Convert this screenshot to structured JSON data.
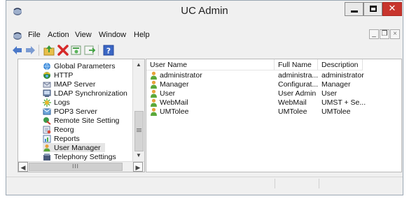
{
  "window": {
    "title": "UC Admin"
  },
  "menubar": {
    "items": [
      "File",
      "Action",
      "View",
      "Window",
      "Help"
    ]
  },
  "toolbar": {
    "icons": [
      "back-arrow-icon",
      "forward-arrow-icon",
      "up-folder-icon",
      "delete-icon",
      "properties-icon",
      "export-icon",
      "help-icon"
    ]
  },
  "tree": {
    "items": [
      {
        "label": "Global Parameters",
        "icon": "global-parameters-icon"
      },
      {
        "label": "HTTP",
        "icon": "http-icon"
      },
      {
        "label": "IMAP Server",
        "icon": "imap-server-icon"
      },
      {
        "label": "LDAP Synchronization",
        "icon": "ldap-sync-icon"
      },
      {
        "label": "Logs",
        "icon": "logs-icon"
      },
      {
        "label": "POP3 Server",
        "icon": "pop3-server-icon"
      },
      {
        "label": "Remote Site Setting",
        "icon": "remote-site-icon"
      },
      {
        "label": "Reorg",
        "icon": "reorg-icon"
      },
      {
        "label": "Reports",
        "icon": "reports-icon"
      },
      {
        "label": "User Manager",
        "icon": "user-manager-icon",
        "selected": true
      },
      {
        "label": "Telephony Settings",
        "icon": "telephony-settings-icon"
      }
    ],
    "hscroll_grip": "III"
  },
  "table": {
    "columns": [
      "User Name",
      "Full Name",
      "Description"
    ],
    "rows": [
      {
        "user_name": "administrator",
        "full_name": "administra...",
        "description": "administrator"
      },
      {
        "user_name": "Manager",
        "full_name": "Configurat...",
        "description": "Manager"
      },
      {
        "user_name": "User",
        "full_name": "User Admin",
        "description": "User"
      },
      {
        "user_name": "WebMail",
        "full_name": "WebMail",
        "description": "UMST + Se..."
      },
      {
        "user_name": "UMTolee",
        "full_name": "UMTolee",
        "description": "UMTolee"
      }
    ]
  },
  "colors": {
    "chrome": "#f0f0f0",
    "close_button": "#c8352d",
    "selection": "#e5e5e5",
    "user_icon_orange": "#e8a23a",
    "user_icon_green": "#5aa83a"
  }
}
